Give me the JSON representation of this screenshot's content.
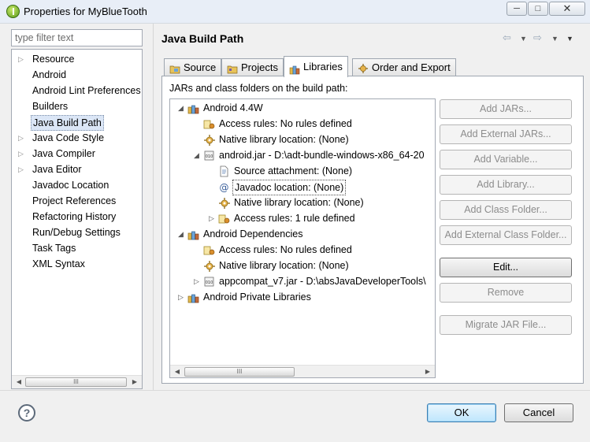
{
  "window": {
    "title": "Properties for MyBlueTooth",
    "min_glyph": "─",
    "max_glyph": "□",
    "close_glyph": "✕"
  },
  "filter": {
    "placeholder": "type filter text"
  },
  "nav": {
    "items": [
      {
        "label": "Resource",
        "expandable": true
      },
      {
        "label": "Android",
        "expandable": false
      },
      {
        "label": "Android Lint Preferences",
        "expandable": false
      },
      {
        "label": "Builders",
        "expandable": false
      },
      {
        "label": "Java Build Path",
        "expandable": false,
        "selected": true
      },
      {
        "label": "Java Code Style",
        "expandable": true
      },
      {
        "label": "Java Compiler",
        "expandable": true
      },
      {
        "label": "Java Editor",
        "expandable": true
      },
      {
        "label": "Javadoc Location",
        "expandable": false
      },
      {
        "label": "Project References",
        "expandable": false
      },
      {
        "label": "Refactoring History",
        "expandable": false
      },
      {
        "label": "Run/Debug Settings",
        "expandable": false
      },
      {
        "label": "Task Tags",
        "expandable": false
      },
      {
        "label": "XML Syntax",
        "expandable": false
      }
    ]
  },
  "page": {
    "title": "Java Build Path",
    "back_glyph": "⇦",
    "forward_glyph": "⇨",
    "dropdown_glyph": "▼",
    "tabs": [
      {
        "label": "Source",
        "icon": "source-folder-icon"
      },
      {
        "label": "Projects",
        "icon": "projects-icon"
      },
      {
        "label": "Libraries",
        "icon": "libraries-icon",
        "active": true
      },
      {
        "label": "Order and Export",
        "icon": "order-export-icon"
      }
    ],
    "description": "JARs and class folders on the build path:"
  },
  "tree": [
    {
      "label": "Android 4.4W",
      "level": 0,
      "toggle": "expanded",
      "icon": "library-icon"
    },
    {
      "label": "Access rules: No rules defined",
      "level": 1,
      "toggle": "none",
      "icon": "access-rules-icon"
    },
    {
      "label": "Native library location: (None)",
      "level": 1,
      "toggle": "none",
      "icon": "native-library-icon"
    },
    {
      "label": "android.jar - D:\\adt-bundle-windows-x86_64-20",
      "level": 1,
      "toggle": "expanded",
      "icon": "jar-icon"
    },
    {
      "label": "Source attachment: (None)",
      "level": 2,
      "toggle": "none",
      "icon": "source-attachment-icon"
    },
    {
      "label": "Javadoc location: (None)",
      "level": 2,
      "toggle": "none",
      "icon": "javadoc-icon",
      "selected": true
    },
    {
      "label": "Native library location: (None)",
      "level": 2,
      "toggle": "none",
      "icon": "native-library-icon"
    },
    {
      "label": "Access rules: 1 rule defined",
      "level": 2,
      "toggle": "collapsed",
      "icon": "access-rules-icon"
    },
    {
      "label": "Android Dependencies",
      "level": 0,
      "toggle": "expanded",
      "icon": "library-icon"
    },
    {
      "label": "Access rules: No rules defined",
      "level": 1,
      "toggle": "none",
      "icon": "access-rules-icon"
    },
    {
      "label": "Native library location: (None)",
      "level": 1,
      "toggle": "none",
      "icon": "native-library-icon"
    },
    {
      "label": "appcompat_v7.jar - D:\\absJavaDeveloperTools\\",
      "level": 1,
      "toggle": "collapsed",
      "icon": "jar-icon"
    },
    {
      "label": "Android Private Libraries",
      "level": 0,
      "toggle": "collapsed",
      "icon": "library-icon"
    }
  ],
  "buttons": [
    {
      "label": "Add JARs...",
      "enabled": false
    },
    {
      "label": "Add External JARs...",
      "enabled": false
    },
    {
      "label": "Add Variable...",
      "enabled": false
    },
    {
      "label": "Add Library...",
      "enabled": false
    },
    {
      "label": "Add Class Folder...",
      "enabled": false
    },
    {
      "label": "Add External Class Folder...",
      "enabled": false
    },
    {
      "label": "Edit...",
      "enabled": true
    },
    {
      "label": "Remove",
      "enabled": false
    },
    {
      "label": "Migrate JAR File...",
      "enabled": false
    }
  ],
  "scroll": {
    "left_glyph": "◀",
    "right_glyph": "▶",
    "grip_glyph": "III"
  },
  "dialog": {
    "help_glyph": "?",
    "ok_label": "OK",
    "cancel_label": "Cancel"
  }
}
